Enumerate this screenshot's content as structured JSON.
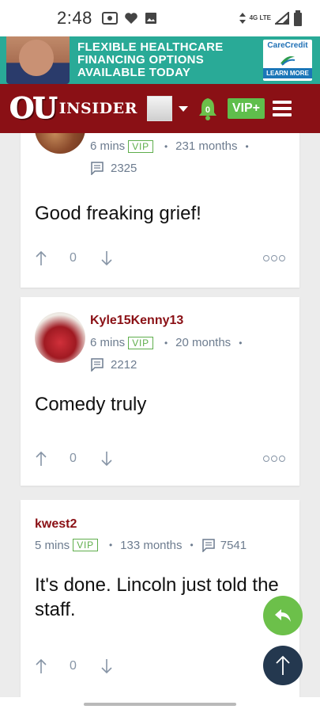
{
  "status_bar": {
    "time": "2:48",
    "network": "4G LTE"
  },
  "ad": {
    "headline_lines": [
      "FLEXIBLE HEALTHCARE",
      "FINANCING OPTIONS",
      "AVAILABLE TODAY"
    ],
    "brand": "CareCredit",
    "cta": "LEARN MORE"
  },
  "header": {
    "logo_ou": "OU",
    "logo_insider": "INSIDER",
    "notification_count": "0",
    "vip_label": "VIP+"
  },
  "posts": [
    {
      "username": "",
      "time": "6 mins",
      "vip": "VIP",
      "tenure": "231 months",
      "reply_count": "2325",
      "body": "Good freaking grief!",
      "votes": "0"
    },
    {
      "username": "Kyle15Kenny13",
      "time": "6 mins",
      "vip": "VIP",
      "tenure": "20 months",
      "reply_count": "2212",
      "body": "Comedy truly",
      "votes": "0"
    },
    {
      "username": "kwest2",
      "time": "5 mins",
      "vip": "VIP",
      "tenure": "133 months",
      "reply_count": "7541",
      "body": "It's done. Lincoln just told the staff.",
      "votes": "0"
    }
  ],
  "colors": {
    "brand_red": "#8a1015",
    "vip_green": "#5fbe4c",
    "meta_gray": "#6d7c8f",
    "fab_dark": "#24384f"
  }
}
